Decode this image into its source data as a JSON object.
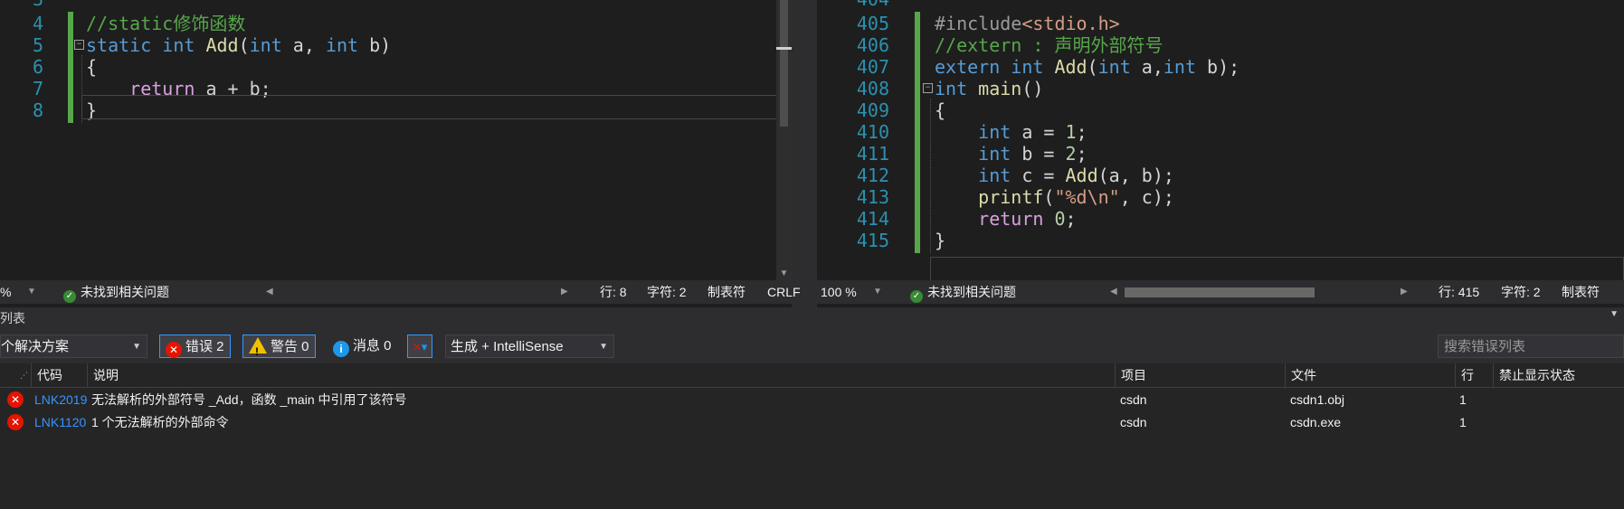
{
  "left_editor": {
    "lines": [
      {
        "num": "4",
        "tokens": [
          {
            "t": "//static修饰函数",
            "c": "cm"
          }
        ]
      },
      {
        "num": "5",
        "tokens": [
          {
            "t": "static",
            "c": "kw"
          },
          {
            "t": " "
          },
          {
            "t": "int",
            "c": "kw"
          },
          {
            "t": " "
          },
          {
            "t": "Add",
            "c": "fn"
          },
          {
            "t": "("
          },
          {
            "t": "int",
            "c": "kw"
          },
          {
            "t": " a, "
          },
          {
            "t": "int",
            "c": "kw"
          },
          {
            "t": " b)"
          }
        ]
      },
      {
        "num": "6",
        "tokens": [
          {
            "t": "{"
          }
        ]
      },
      {
        "num": "7",
        "tokens": [
          {
            "t": "    "
          },
          {
            "t": "return",
            "c": "ret"
          },
          {
            "t": " a + b;"
          }
        ]
      },
      {
        "num": "8",
        "tokens": [
          {
            "t": "}"
          }
        ]
      }
    ]
  },
  "right_editor": {
    "lines": [
      {
        "num": "405",
        "tokens": [
          {
            "t": "#include",
            "c": "pp"
          },
          {
            "t": "<stdio.h>",
            "c": "str"
          }
        ]
      },
      {
        "num": "406",
        "tokens": [
          {
            "t": "//extern : 声明外部符号",
            "c": "cm"
          }
        ]
      },
      {
        "num": "407",
        "tokens": [
          {
            "t": "extern",
            "c": "kw"
          },
          {
            "t": " "
          },
          {
            "t": "int",
            "c": "kw"
          },
          {
            "t": " "
          },
          {
            "t": "Add",
            "c": "fn"
          },
          {
            "t": "("
          },
          {
            "t": "int",
            "c": "kw"
          },
          {
            "t": " a,"
          },
          {
            "t": "int",
            "c": "kw"
          },
          {
            "t": " b);"
          }
        ]
      },
      {
        "num": "408",
        "tokens": [
          {
            "t": "int",
            "c": "kw"
          },
          {
            "t": " "
          },
          {
            "t": "main",
            "c": "fn"
          },
          {
            "t": "()"
          }
        ]
      },
      {
        "num": "409",
        "tokens": [
          {
            "t": "{"
          }
        ]
      },
      {
        "num": "410",
        "tokens": [
          {
            "t": "    "
          },
          {
            "t": "int",
            "c": "kw"
          },
          {
            "t": " a = "
          },
          {
            "t": "1",
            "c": "num"
          },
          {
            "t": ";"
          }
        ]
      },
      {
        "num": "411",
        "tokens": [
          {
            "t": "    "
          },
          {
            "t": "int",
            "c": "kw"
          },
          {
            "t": " b = "
          },
          {
            "t": "2",
            "c": "num"
          },
          {
            "t": ";"
          }
        ]
      },
      {
        "num": "412",
        "tokens": [
          {
            "t": "    "
          },
          {
            "t": "int",
            "c": "kw"
          },
          {
            "t": " c = "
          },
          {
            "t": "Add",
            "c": "fn"
          },
          {
            "t": "(a, b);"
          }
        ]
      },
      {
        "num": "413",
        "tokens": [
          {
            "t": "    "
          },
          {
            "t": "printf",
            "c": "fn"
          },
          {
            "t": "("
          },
          {
            "t": "\"%d\\n\"",
            "c": "str"
          },
          {
            "t": ", c);"
          }
        ]
      },
      {
        "num": "414",
        "tokens": [
          {
            "t": "    "
          },
          {
            "t": "return",
            "c": "ret"
          },
          {
            "t": " "
          },
          {
            "t": "0",
            "c": "num"
          },
          {
            "t": ";"
          }
        ]
      },
      {
        "num": "415",
        "tokens": [
          {
            "t": "}"
          }
        ]
      }
    ]
  },
  "left_status": {
    "zoom": "%",
    "issues": "未找到相关问题",
    "line": "行: 8",
    "char": "字符: 2",
    "tabs": "制表符",
    "eol": "CRLF"
  },
  "right_status": {
    "zoom": "100 %",
    "issues": "未找到相关问题",
    "line": "行: 415",
    "char": "字符: 2",
    "tabs": "制表符"
  },
  "error_panel": {
    "title": "列表",
    "scope": "个解决方案",
    "errors_label": "错误 2",
    "warnings_label": "警告 0",
    "messages_label": "消息 0",
    "build_filter": "生成 + IntelliSense",
    "search_placeholder": "搜索错误列表",
    "columns": {
      "code": "代码",
      "description": "说明",
      "project": "项目",
      "file": "文件",
      "line": "行",
      "suppression": "禁止显示状态"
    },
    "rows": [
      {
        "code": "LNK2019",
        "description": "无法解析的外部符号 _Add，函数 _main 中引用了该符号",
        "project": "csdn",
        "file": "csdn1.obj",
        "line": "1"
      },
      {
        "code": "LNK1120",
        "description": "1 个无法解析的外部命令",
        "project": "csdn",
        "file": "csdn.exe",
        "line": "1"
      }
    ]
  },
  "colors": {
    "editor_bg": "#1e1e1e",
    "keyword": "#569cd6",
    "comment": "#57a64a",
    "function": "#dcdcaa",
    "string": "#d69d85",
    "return_kw": "#d8a0df",
    "line_number": "#2b91af",
    "error_red": "#e51400",
    "link_blue": "#3794ff"
  }
}
